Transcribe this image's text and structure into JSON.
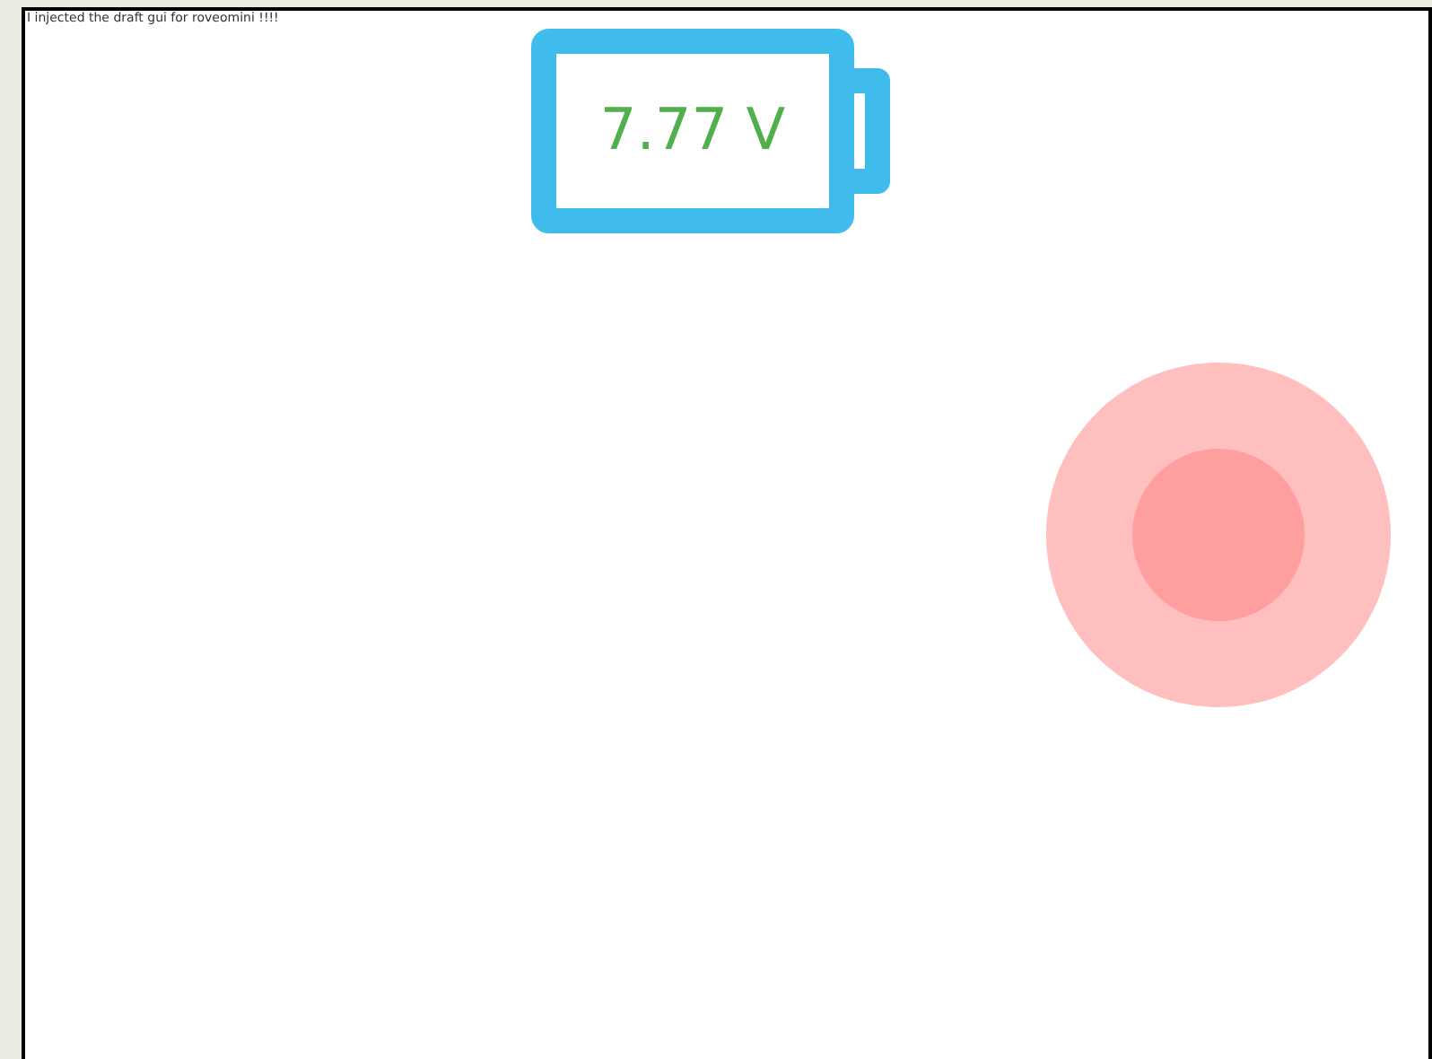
{
  "message": "I injected the draft gui for roveomini !!!!",
  "battery": {
    "voltage": "7.77 V"
  }
}
